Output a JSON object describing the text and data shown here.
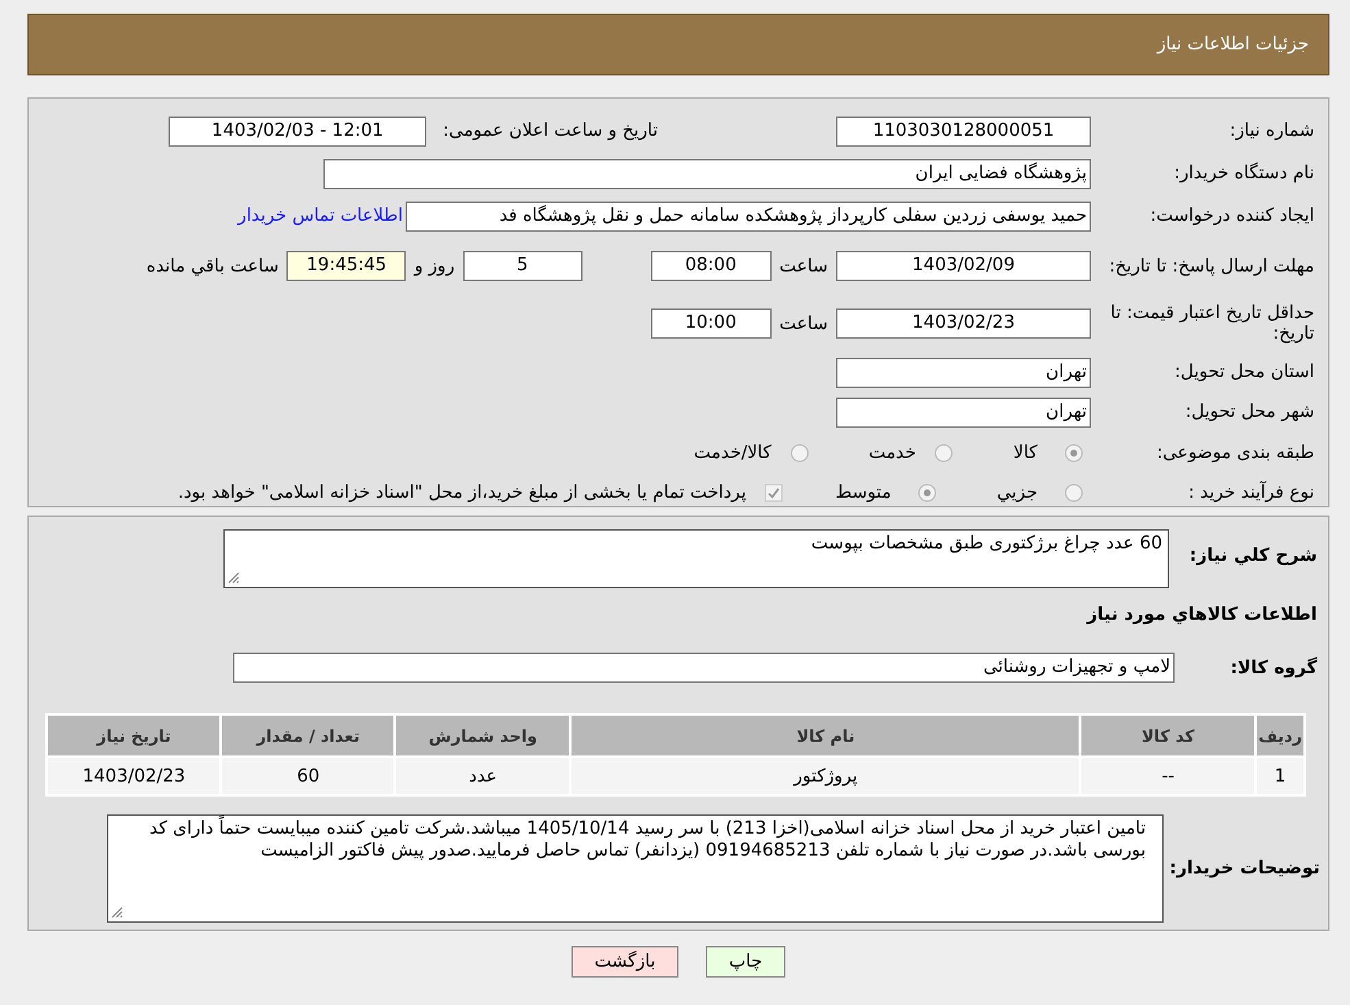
{
  "header": {
    "title": "جزئیات اطلاعات نیاز"
  },
  "need_number": {
    "label": "شماره نیاز:",
    "value": "1103030128000051"
  },
  "announce": {
    "label": "تاریخ و ساعت اعلان عمومی:",
    "value": "1403/02/03 - 12:01"
  },
  "buyer": {
    "label": "نام دستگاه خریدار:",
    "value": "پژوهشگاه فضایی ایران"
  },
  "creator": {
    "label": "ایجاد کننده درخواست:",
    "value": "حمید یوسفی زردین سفلی کارپرداز پژوهشکده سامانه حمل و نقل پژوهشگاه فد",
    "link": "اطلاعات تماس خریدار"
  },
  "reply_deadline": {
    "label": "مهلت ارسال پاسخ: تا تاریخ:",
    "date": "1403/02/09",
    "time_label": "ساعت",
    "time": "08:00",
    "days": "5",
    "days_label": "روز و",
    "remaining": "19:45:45",
    "remaining_label": "ساعت باقي مانده"
  },
  "price_validity": {
    "label": "حداقل تاریخ اعتبار قیمت: تا تاریخ:",
    "date": "1403/02/23",
    "time_label": "ساعت",
    "time": "10:00"
  },
  "province": {
    "label": "استان محل تحویل:",
    "value": "تهران"
  },
  "city": {
    "label": "شهر محل تحویل:",
    "value": "تهران"
  },
  "category": {
    "label": "طبقه بندی موضوعی:",
    "options": [
      {
        "label": "کالا",
        "selected": true
      },
      {
        "label": "خدمت",
        "selected": false
      },
      {
        "label": "کالا/خدمت",
        "selected": false
      }
    ]
  },
  "purchase_type": {
    "label": "نوع فرآیند خرید :",
    "options": [
      {
        "label": "جزيي",
        "selected": false
      },
      {
        "label": "متوسط",
        "selected": true
      }
    ],
    "payment": {
      "checked": true,
      "label": "پرداخت تمام یا بخشی از مبلغ خرید،از محل \"اسناد خزانه اسلامی\" خواهد بود."
    }
  },
  "description": {
    "label": "شرح کلي نياز:",
    "value": "60 عدد چراغ برژکتوری طبق مشخصات بپوست"
  },
  "goods_heading": "اطلاعات کالاهاي مورد نياز",
  "goods_group": {
    "label": "گروه کالا:",
    "value": "لامپ و تجهیزات روشنائی"
  },
  "table": {
    "columns": [
      "ردیف",
      "کد کالا",
      "نام کالا",
      "واحد شمارش",
      "تعداد / مقدار",
      "تاریخ نیاز"
    ],
    "rows": [
      [
        "1",
        "--",
        "پروژکتور",
        "عدد",
        "60",
        "1403/02/23"
      ]
    ]
  },
  "buyer_notes": {
    "label": "توضیحات خریدار:",
    "value": "تامین اعتبار خرید از محل اسناد خزانه اسلامی(اخزا 213) با سر رسید 1405/10/14 میباشد.شرکت تامین کننده میبایست حتماً دارای کد بورسی باشد.در صورت نیاز با شماره تلفن 09194685213 (یزدانفر) تماس حاصل فرمایید.صدور پیش فاکتور الزامیست"
  },
  "buttons": [
    {
      "label": "چاپ",
      "kind": "print"
    },
    {
      "label": "بازگشت",
      "kind": "back"
    }
  ]
}
